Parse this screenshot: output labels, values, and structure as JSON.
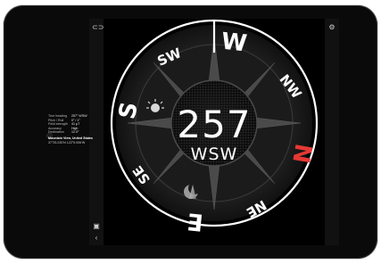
{
  "compass": {
    "heading_degrees": "257",
    "heading_direction": "WSW"
  },
  "cardinal_labels": {
    "north": "N",
    "south": "S",
    "east": "E",
    "west": "W",
    "northwest": "NW",
    "southwest": "SW",
    "southeast": "SE",
    "northeast": "NE"
  },
  "info_panel": {
    "rows": [
      {
        "label": "True heading",
        "value": "257° WSW"
      },
      {
        "label": "Pitch / Roll",
        "value": "0° / 1°"
      },
      {
        "label": "Field strength",
        "value": "41 µT"
      },
      {
        "label": "Accuracy",
        "value": "High"
      },
      {
        "label": "Declination",
        "value": "12.0°"
      }
    ],
    "location": "Mountain View, United States",
    "coordinates": "37°25.230'N 122°5.006'W"
  },
  "icons": {
    "top_left": "link-icon",
    "top_right": "gear-icon",
    "bottom_left": "image-icon",
    "back": "chevron-left-icon",
    "sun": "sun-icon",
    "moon": "moon-icon"
  },
  "colors": {
    "north_marker": "#e53935",
    "ring": "#ffffff",
    "background": "#000000"
  }
}
